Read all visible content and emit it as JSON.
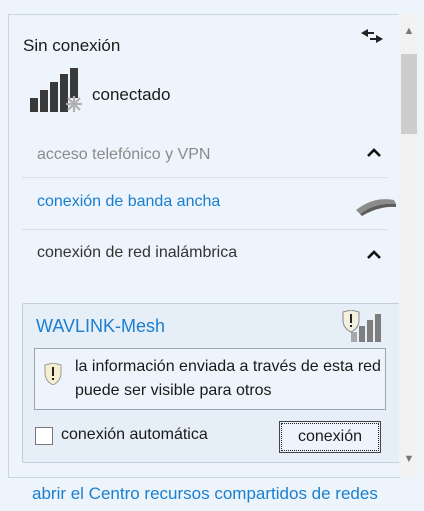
{
  "header": {
    "title": "Sin conexión",
    "sync_icon": "arrows-swap-icon"
  },
  "status": {
    "label": "conectado",
    "icon": "signal-bars-star-icon"
  },
  "sections": {
    "dialup": {
      "label": "acceso telefónico y VPN",
      "state": "collapsed"
    },
    "broadband": {
      "label": "conexión de banda ancha",
      "icon": "broadband-modem-icon"
    },
    "wireless": {
      "label": "conexión de red inalámbrica",
      "state": "expanded"
    }
  },
  "network": {
    "ssid": "WAVLINK-Mesh",
    "icon": "wifi-signal-warning-icon",
    "warning": "la información enviada a través de esta red puede ser visible para otros",
    "auto_connect_label": "conexión automática",
    "auto_connect_checked": false,
    "connect_button": "conexión"
  },
  "footer": {
    "link": "abrir el Centro recursos compartidos de redes"
  },
  "colors": {
    "accent": "#1a7fd0",
    "background": "#eef4fb",
    "muted": "#8a8a8a"
  }
}
